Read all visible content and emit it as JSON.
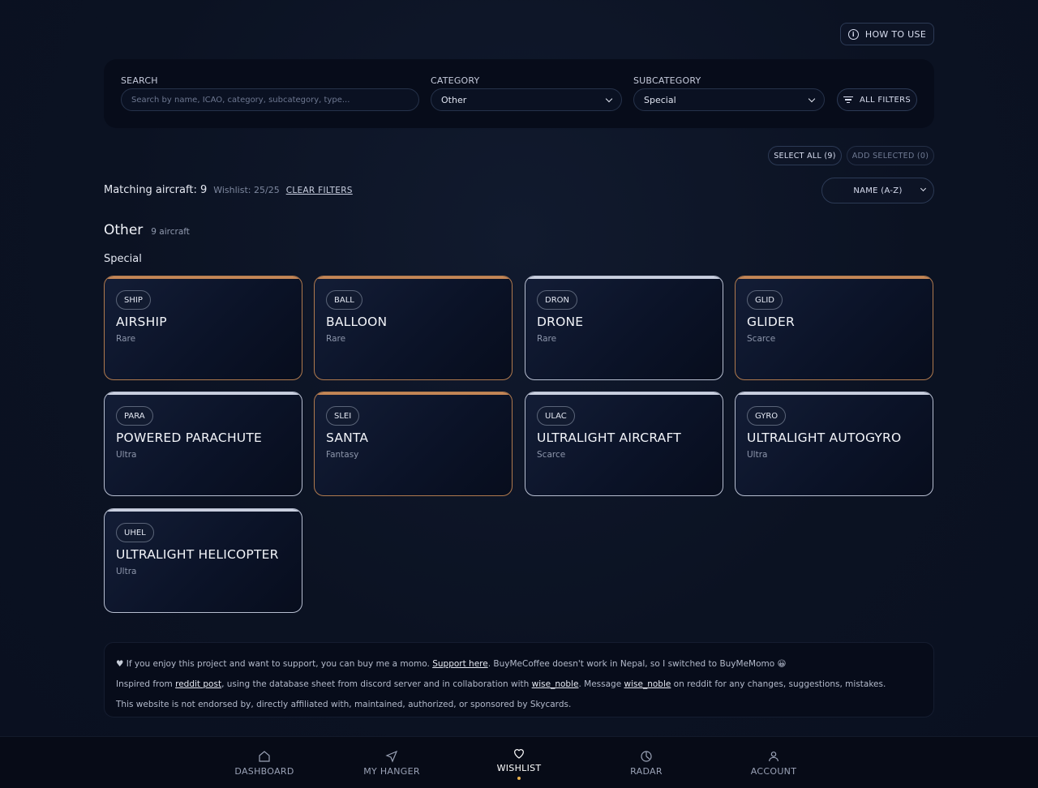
{
  "header": {
    "how_to_use": "HOW TO USE"
  },
  "filters": {
    "search_label": "SEARCH",
    "search_placeholder": "Search by name, ICAO, category, subcategory, type...",
    "category_label": "CATEGORY",
    "category_value": "Other",
    "subcategory_label": "SUBCATEGORY",
    "subcategory_value": "Special",
    "all_filters": "ALL FILTERS"
  },
  "actions": {
    "select_all": "SELECT ALL (9)",
    "add_selected": "ADD SELECTED (0)"
  },
  "summary": {
    "matching": "Matching aircraft: 9",
    "wishlist": "Wishlist: 25/25",
    "clear_filters": "CLEAR FILTERS",
    "sort_value": "NAME (A-Z)"
  },
  "group": {
    "title": "Other",
    "count": "9 aircraft",
    "subgroup": "Special"
  },
  "cards": [
    {
      "code": "SHIP",
      "name": "AIRSHIP",
      "rarity": "Rare"
    },
    {
      "code": "BALL",
      "name": "BALLOON",
      "rarity": "Rare"
    },
    {
      "code": "DRON",
      "name": "DRONE",
      "rarity": "Rare"
    },
    {
      "code": "GLID",
      "name": "GLIDER",
      "rarity": "Scarce"
    },
    {
      "code": "PARA",
      "name": "POWERED PARACHUTE",
      "rarity": "Ultra"
    },
    {
      "code": "SLEI",
      "name": "SANTA",
      "rarity": "Fantasy"
    },
    {
      "code": "ULAC",
      "name": "ULTRALIGHT AIRCRAFT",
      "rarity": "Scarce"
    },
    {
      "code": "GYRO",
      "name": "ULTRALIGHT AUTOGYRO",
      "rarity": "Ultra"
    },
    {
      "code": "UHEL",
      "name": "ULTRALIGHT HELICOPTER",
      "rarity": "Ultra"
    }
  ],
  "footer": {
    "line1_pre": "If you enjoy this project and want to support, you can buy me a momo.",
    "line1_link": "Support here",
    "line1_post": ". BuyMeCoffee doesn't work in Nepal, so I switched to BuyMeMomo 😀",
    "line2_pre": "Inspired from",
    "line2_link1": "reddit post",
    "line2_mid1": ", using the database sheet from discord server and in collaboration with",
    "line2_link2": "wise_noble",
    "line2_mid2": ". Message",
    "line2_link3": "wise_noble",
    "line2_post": "on reddit for any changes, suggestions, mistakes.",
    "line3": "This website is not endorsed by, directly affiliated with, maintained, authorized, or sponsored by Skycards."
  },
  "nav": [
    {
      "label": "DASHBOARD",
      "icon": "home-icon"
    },
    {
      "label": "MY HANGER",
      "icon": "navigation-icon"
    },
    {
      "label": "WISHLIST",
      "icon": "heart-icon"
    },
    {
      "label": "RADAR",
      "icon": "radar-icon"
    },
    {
      "label": "ACCOUNT",
      "icon": "user-icon"
    }
  ],
  "colors": {
    "accent_dot": "#e9b04b",
    "rare_border": "#c48656",
    "default_border": "#c9cfdf"
  }
}
